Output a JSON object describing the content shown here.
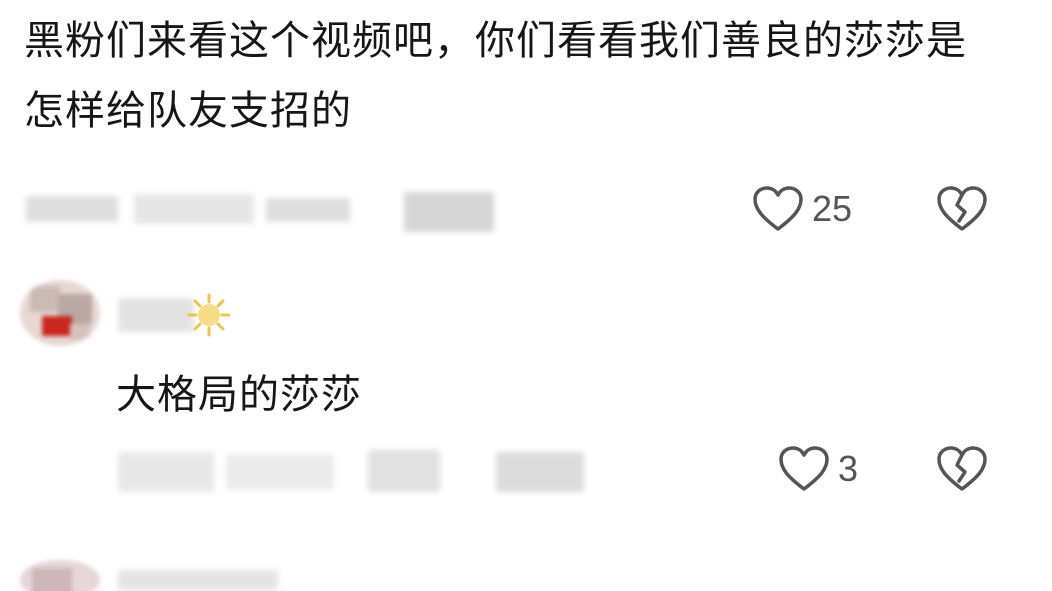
{
  "comments": [
    {
      "text": "黑粉们来看这个视频吧，你们看看我们善良的莎莎是怎样给队友支招的",
      "likes": "25"
    },
    {
      "text": "大格局的莎莎",
      "likes": "3"
    }
  ],
  "icons": {
    "like": "heart-outline-icon",
    "dislike": "broken-heart-icon",
    "emoji": "sun-emoji-icon"
  },
  "colors": {
    "text": "#161616",
    "icon": "#555555",
    "blur": "#d9d9d9",
    "avatar_red": "#c8281e"
  }
}
